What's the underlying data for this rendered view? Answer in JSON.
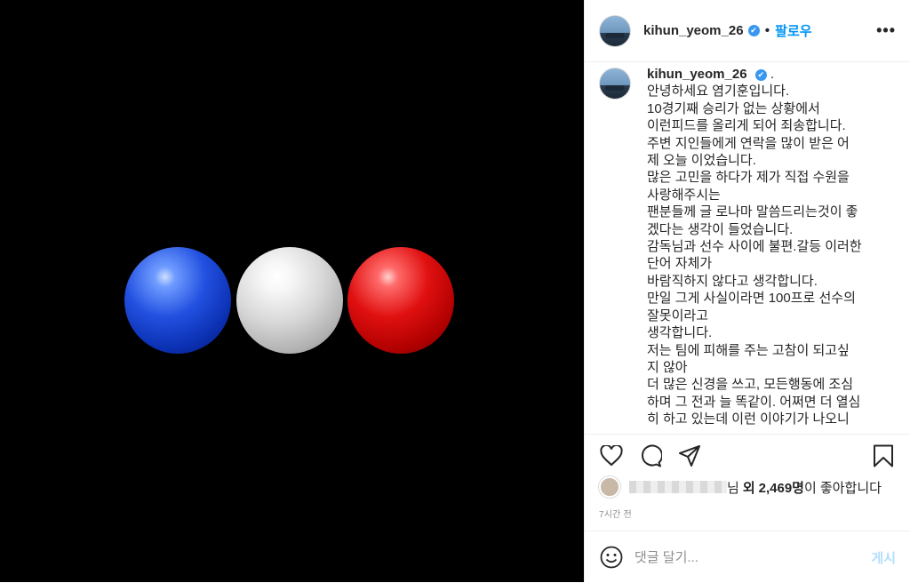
{
  "header": {
    "username": "kihun_yeom_26",
    "verified_glyph": "✔",
    "separator": "•",
    "follow_label": "팔로우",
    "more_label": "•••"
  },
  "caption": {
    "username": "kihun_yeom_26",
    "verified_glyph": "✔",
    "trailing_dot": ".",
    "lines": [
      "안녕하세요 염기훈입니다.",
      "10경기째 승리가 없는 상황에서",
      "이런피드를 올리게 되어 죄송합니다.",
      "주변 지인들에게 연락을 많이 받은 어",
      "제 오늘 이었습니다.",
      "많은 고민을 하다가 제가 직접 수원을",
      "사랑해주시는",
      "팬분들께 글 로나마 말씀드리는것이 좋",
      "겠다는 생각이 들었습니다.",
      "감독님과 선수 사이에 불편.갈등 이러한",
      "단어 자체가",
      "바람직하지 않다고 생각합니다.",
      "만일 그게 사실이라면 100프로 선수의",
      "잘못이라고",
      "생각합니다.",
      "저는 팀에 피해를 주는 고참이 되고싶",
      "지 않아",
      "더 많은 신경을 쓰고, 모든행동에 조심",
      "하며 그 전과 늘 똑같이. 어쩌면 더 열심",
      "히 하고 있는데 이런 이야기가 나오니"
    ]
  },
  "actions": {
    "icons": [
      "heart-icon",
      "comment-icon",
      "share-icon",
      "bookmark-icon"
    ]
  },
  "likes": {
    "suffix_nim": "님",
    "and_others": "외",
    "count": "2,469명",
    "tail": "이 좋아합니다"
  },
  "timestamp": "7시간 전",
  "comment_box": {
    "placeholder": "댓글 달기...",
    "post_label": "게시"
  },
  "colors": {
    "accent": "#0095f6",
    "post_disabled": "#b2dffc",
    "media_bg": "#000000"
  }
}
